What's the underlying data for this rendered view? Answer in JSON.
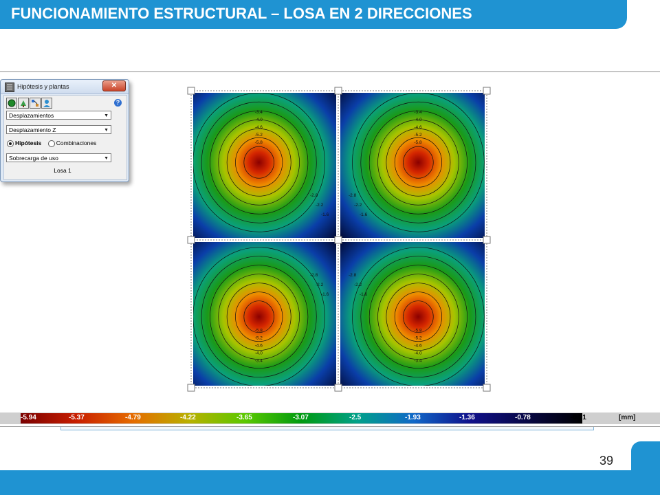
{
  "slide": {
    "title": "FUNCIONAMIENTO ESTRUCTURAL – LOSA EN 2 DIRECCIONES",
    "page_number": "39",
    "accent_color": "#1f93d2"
  },
  "dialog": {
    "title": "Hipótesis y plantas",
    "close_label": "✕",
    "icons": [
      "app-grid-icon",
      "green-circle-icon",
      "tree-icon",
      "diagram-icon",
      "user-icon",
      "help-icon"
    ],
    "select_1": "Desplazamientos",
    "select_2": "Desplazamiento Z",
    "radio_1": "Hipótesis",
    "radio_2": "Combinaciones",
    "radio_selected": "Hipótesis",
    "select_3": "Sobrecarga de uso",
    "losa_button": "Losa 1"
  },
  "contour_plot": {
    "quantity": "Desplazamiento Z",
    "panels": 4,
    "labels_top_panel": [
      "-3.4",
      "-4.0",
      "-4.6",
      "-5.2",
      "-5.8"
    ],
    "labels_bottom_panel": [
      "-5.8",
      "-5.2",
      "-4.6",
      "-4.0",
      "-3.4"
    ],
    "labels_side": [
      "-2.8",
      "-2.2",
      "-1.6"
    ]
  },
  "color_scale": {
    "unit": "[mm]",
    "ticks": [
      "-5.94",
      "-5.37",
      "-4.79",
      "-4.22",
      "-3.65",
      "-3.07",
      "-2.5",
      "-1.93",
      "-1.36",
      "-0.78",
      "-0.21"
    ],
    "colors": [
      "#7a0000",
      "#c81e00",
      "#e56c00",
      "#b8b000",
      "#5ac800",
      "#009a10",
      "#00a08a",
      "#1168c8",
      "#10108a",
      "#050530",
      "#000000"
    ]
  }
}
